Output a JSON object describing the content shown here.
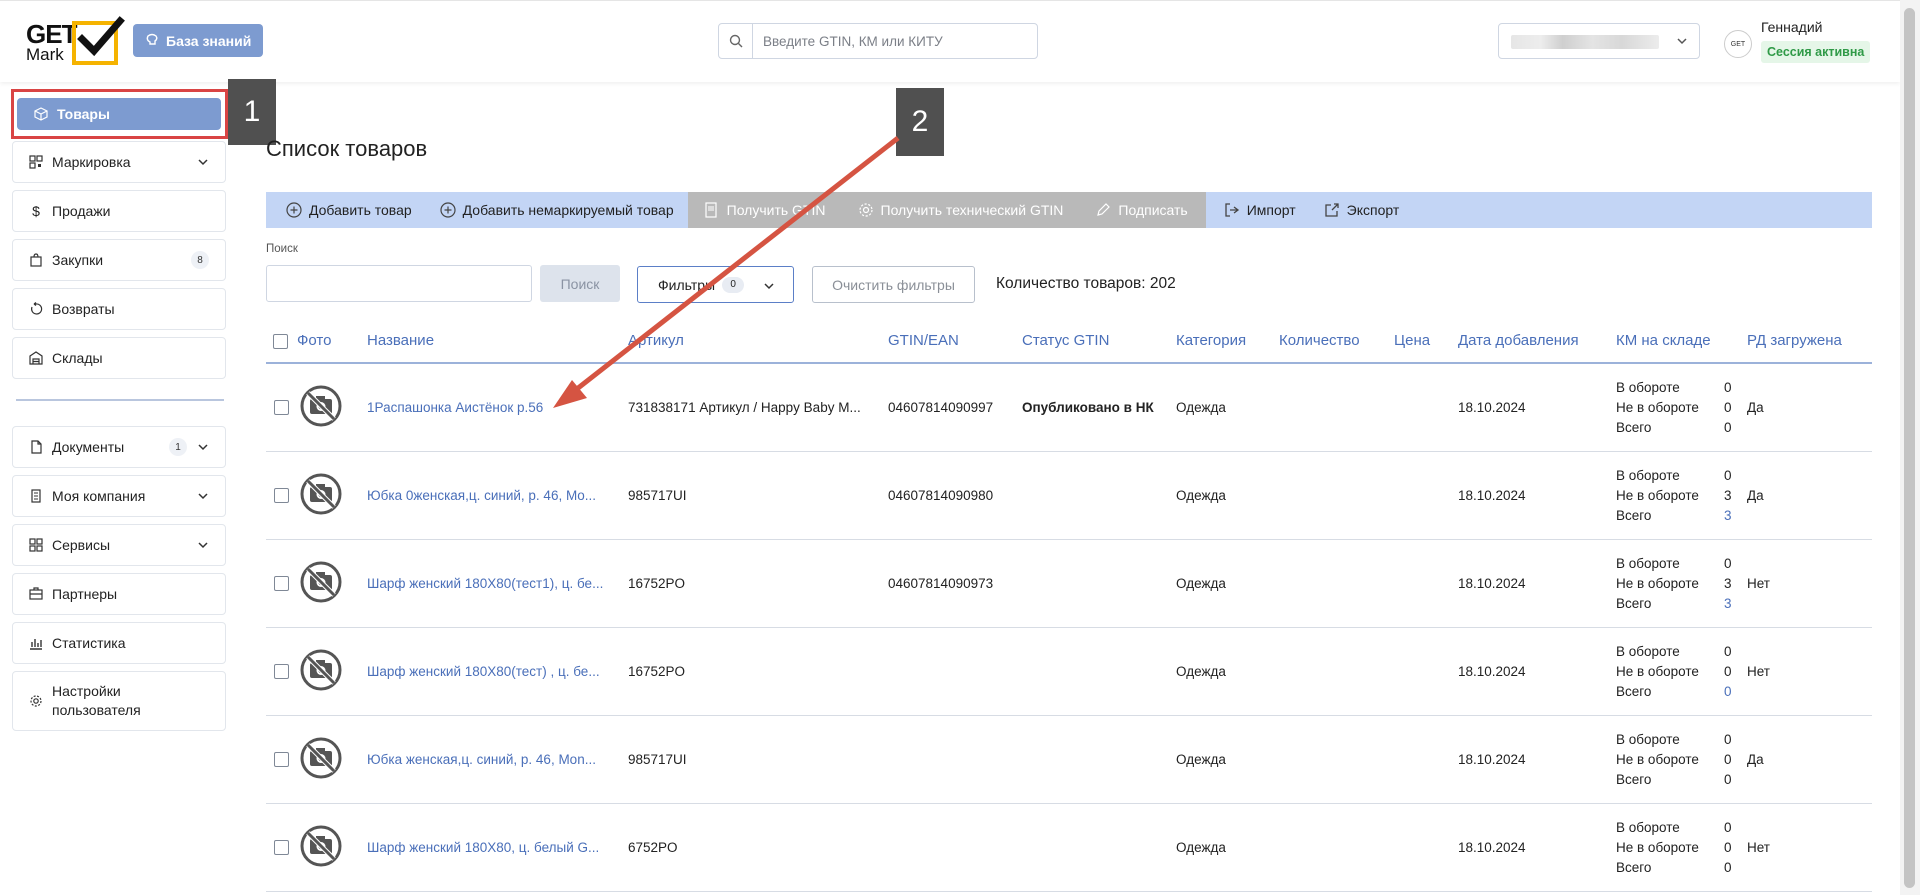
{
  "header": {
    "logo_top": "GET",
    "logo_bottom": "Mark",
    "kb_button": "База знаний",
    "search_placeholder": "Введите GTIN, КМ или КИТУ",
    "avatar_text": "GET",
    "user_name": "Геннадий",
    "session_status": "Сессия активна"
  },
  "sidebar": {
    "items": [
      {
        "label": "Товары",
        "icon": "cube-icon"
      },
      {
        "label": "Маркировка",
        "icon": "qr-code-icon"
      },
      {
        "label": "Продажи",
        "icon": "dollar-icon"
      },
      {
        "label": "Закупки",
        "icon": "shopping-bag-icon",
        "badge": "8"
      },
      {
        "label": "Возвраты",
        "icon": "return-icon"
      },
      {
        "label": "Склады",
        "icon": "warehouse-icon"
      },
      {
        "label": "Документы",
        "icon": "document-icon",
        "badge": "1"
      },
      {
        "label": "Моя компания",
        "icon": "building-icon"
      },
      {
        "label": "Сервисы",
        "icon": "grid-icon"
      },
      {
        "label": "Партнеры",
        "icon": "partners-icon"
      },
      {
        "label": "Статистика",
        "icon": "chart-icon"
      },
      {
        "label": "Настройки пользователя",
        "icon": "gear-icon"
      }
    ]
  },
  "annotations": {
    "step1": "1",
    "step2": "2"
  },
  "main": {
    "title": "Список товаров",
    "toolbar": {
      "add_product": "Добавить товар",
      "add_unmarked": "Добавить немаркируемый товар",
      "get_gtin": "Получить GTIN",
      "get_tech_gtin": "Получить технический GTIN",
      "sign": "Подписать",
      "import": "Импорт",
      "export": "Экспорт"
    },
    "search_label": "Поиск",
    "search_button": "Поиск",
    "filters_label": "Фильтры",
    "filters_count": "0",
    "clear_filters": "Очистить фильтры",
    "total": "Количество товаров: 202"
  },
  "table": {
    "columns": [
      "Фото",
      "Название",
      "Артикул",
      "GTIN/EAN",
      "Статус GTIN",
      "Категория",
      "Количество",
      "Цена",
      "Дата добавления",
      "КМ на складе",
      "РД загружена"
    ],
    "km_labels": [
      "В обороте",
      "Не в обороте",
      "Всего"
    ],
    "rows": [
      {
        "name": "1Распашонка Аистёнок р.56",
        "article": "731838171 Артикул / Happy Baby M...",
        "gtin": "04607814090997",
        "status": "Опубликовано в НК",
        "category": "Одежда",
        "date": "18.10.2024",
        "km": [
          "0",
          "0",
          "0"
        ],
        "rd": "Да"
      },
      {
        "name": "Юбка 0женская,ц. синий, р. 46, Mo...",
        "article": "985717UI",
        "gtin": "04607814090980",
        "status": "",
        "category": "Одежда",
        "date": "18.10.2024",
        "km": [
          "0",
          "3",
          "3"
        ],
        "rd": "Да"
      },
      {
        "name": "Шарф женский 180Х80(тест1), ц. бе...",
        "article": "16752PO",
        "gtin": "04607814090973",
        "status": "",
        "category": "Одежда",
        "date": "18.10.2024",
        "km": [
          "0",
          "3",
          "3"
        ],
        "rd": "Нет"
      },
      {
        "name": "Шарф женский 180Х80(тест) , ц. бе...",
        "article": "16752PO",
        "gtin": "",
        "status": "",
        "category": "Одежда",
        "date": "18.10.2024",
        "km": [
          "0",
          "0",
          "0"
        ],
        "rd": "Нет"
      },
      {
        "name": "Юбка женская,ц. синий, р. 46, Mon...",
        "article": "985717UI",
        "gtin": "",
        "status": "",
        "category": "Одежда",
        "date": "18.10.2024",
        "km": [
          "0",
          "0",
          "0"
        ],
        "rd": "Да"
      },
      {
        "name": "Шарф женский 180Х80, ц. белый G...",
        "article": "6752PO",
        "gtin": "",
        "status": "",
        "category": "Одежда",
        "date": "18.10.2024",
        "km": [
          "0",
          "0",
          "0"
        ],
        "rd": "Нет"
      }
    ]
  },
  "colors": {
    "accent": "#7d9bd0",
    "link": "#4a6fb9",
    "toolbar": "#c3d5f5",
    "annotation_red": "#d94444",
    "session_green": "#2f9a47"
  }
}
